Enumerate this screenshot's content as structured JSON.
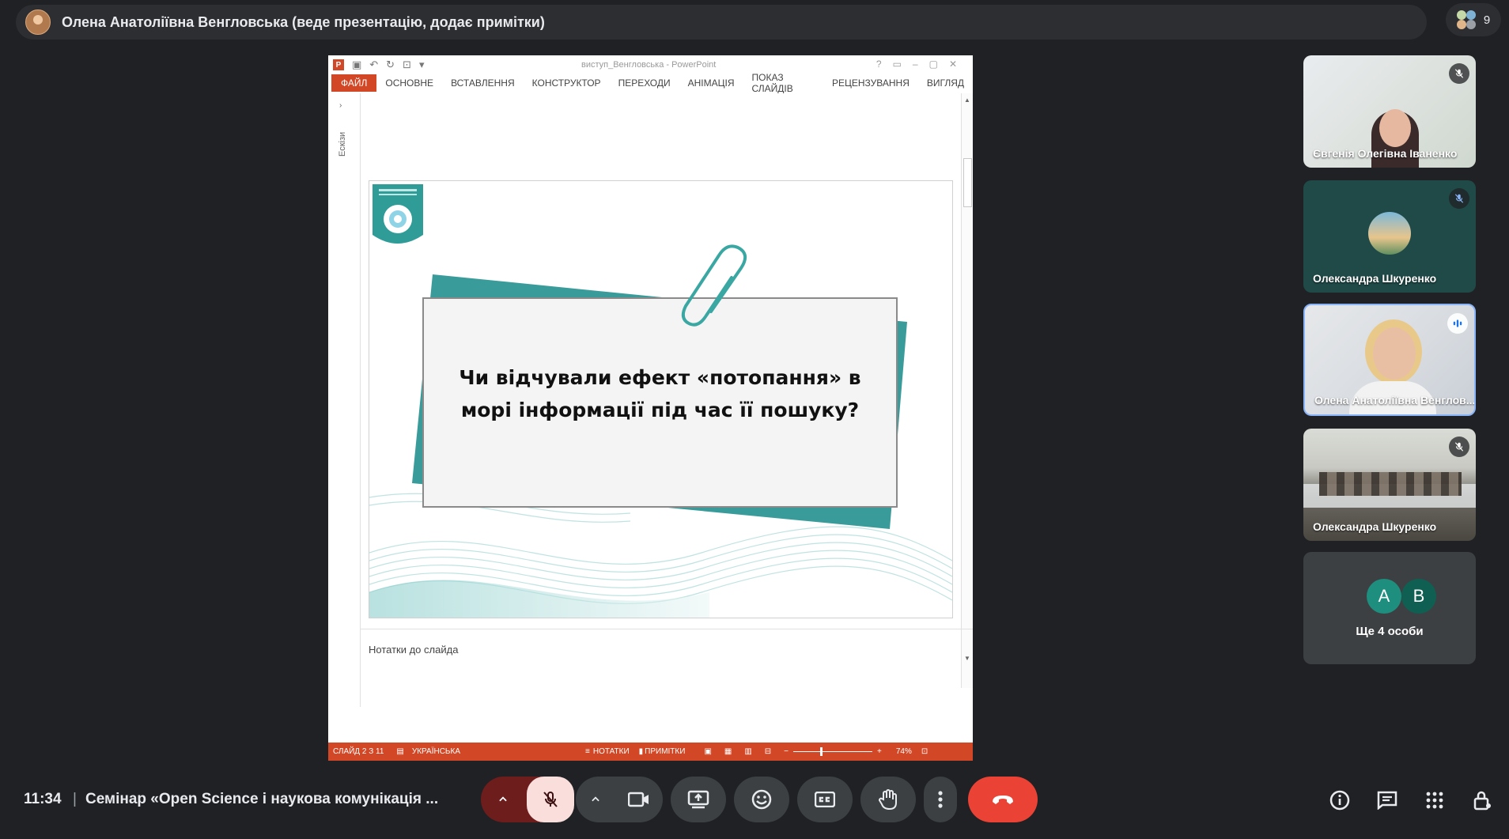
{
  "topbar": {
    "presenter_label": "Олена Анатоліївна Венгловська (веде презентацію, додає примітки)"
  },
  "people": {
    "count": "9"
  },
  "powerpoint": {
    "window_title": "виступ_Венгловська - PowerPoint",
    "tabs": [
      "ФАЙЛ",
      "ОСНОВНЕ",
      "ВСТАВЛЕННЯ",
      "КОНСТРУКТОР",
      "ПЕРЕХОДИ",
      "АНІМАЦІЯ",
      "ПОКАЗ СЛАЙДІВ",
      "РЕЦЕНЗУВАННЯ",
      "ВИГЛЯД"
    ],
    "side_pane_label": "Ескізи",
    "slide": {
      "question_line1": "Чи відчували ефект «потопання» в",
      "question_line2": "морі інформації під час її пошуку?"
    },
    "notes_placeholder": "Нотатки до слайда",
    "status": {
      "slide_info": "СЛАЙД 2 З 11",
      "language": "УКРАЇНСЬКА",
      "notes_btn": "НОТАТКИ",
      "comments_btn": "ПРИМІТКИ",
      "zoom": "74%"
    }
  },
  "participants": [
    {
      "name": "Євгенія Олегівна Іваненко",
      "muted": true
    },
    {
      "name": "Олександра Шкуренко",
      "muted": true
    },
    {
      "name": "Олена Анатоліївна Венглов...",
      "speaking": true
    },
    {
      "name": "Олександра Шкуренко",
      "muted": true
    }
  ],
  "others": {
    "avatar_a": "A",
    "avatar_b": "B",
    "label": "Ще 4 особи"
  },
  "bottom": {
    "time": "11:34",
    "separator": "|",
    "meeting_title": "Семінар «Open Science і наукова комунікація ..."
  },
  "colors": {
    "accent_ppt": "#d24726",
    "teal": "#3a9c9a",
    "end_call": "#ea4335",
    "mic_off_bg": "#f9dedc"
  }
}
